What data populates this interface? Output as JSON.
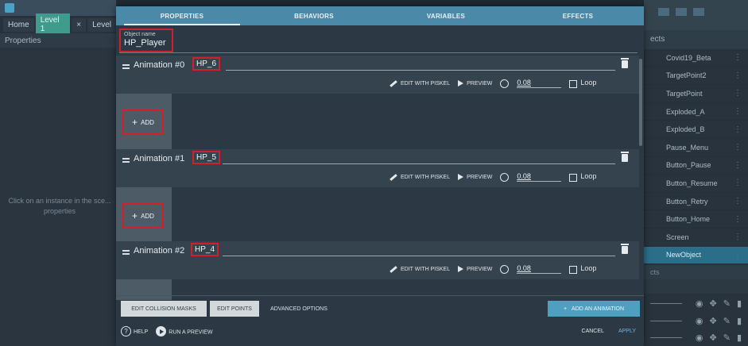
{
  "editor": {
    "tabs": [
      {
        "label": "Home"
      },
      {
        "label": "Level 1"
      },
      {
        "label": "×"
      },
      {
        "label": "Level"
      }
    ],
    "properties_title": "Properties",
    "properties_hint": "Click on an instance in the sce... properties"
  },
  "objects_panel": {
    "title": "ects",
    "items": [
      {
        "label": "Covid19_Beta"
      },
      {
        "label": "TargetPoint2"
      },
      {
        "label": "TargetPoint"
      },
      {
        "label": "Exploded_A"
      },
      {
        "label": "Exploded_B"
      },
      {
        "label": "Pause_Menu"
      },
      {
        "label": "Button_Pause"
      },
      {
        "label": "Button_Resume"
      },
      {
        "label": "Button_Retry"
      },
      {
        "label": "Button_Home"
      },
      {
        "label": "Screen"
      },
      {
        "label": "NewObject"
      }
    ],
    "selected_index": 11,
    "sub_label": "cts"
  },
  "dialog": {
    "tabs": [
      {
        "label": "PROPERTIES"
      },
      {
        "label": "BEHAVIORS"
      },
      {
        "label": "VARIABLES"
      },
      {
        "label": "EFFECTS"
      }
    ],
    "active_tab": "PROPERTIES",
    "object_name_label": "Object name",
    "object_name_value": "HP_Player",
    "animations": [
      {
        "title": "Animation #0",
        "name": "HP_6",
        "edit_label": "EDIT WITH PISKEL",
        "preview_label": "PREVIEW",
        "fps": "0.08",
        "loop_label": "Loop",
        "add_label": "ADD"
      },
      {
        "title": "Animation #1",
        "name": "HP_5",
        "edit_label": "EDIT WITH PISKEL",
        "preview_label": "PREVIEW",
        "fps": "0.08",
        "loop_label": "Loop",
        "add_label": "ADD"
      },
      {
        "title": "Animation #2",
        "name": "HP_4",
        "edit_label": "EDIT WITH PISKEL",
        "preview_label": "PREVIEW",
        "fps": "0.08",
        "loop_label": "Loop"
      }
    ],
    "footer": {
      "edit_collision_masks": "EDIT COLLISION MASKS",
      "edit_points": "EDIT POINTS",
      "advanced_options": "ADVANCED OPTIONS",
      "add_animation": "ADD AN ANIMATION",
      "help": "HELP",
      "run_preview": "RUN A PREVIEW",
      "cancel": "CANCEL",
      "apply": "APPLY"
    }
  },
  "colors": {
    "accent": "#4a8aa8",
    "highlight_border": "#d11f2c",
    "selected_object": "#2b6e8a"
  }
}
